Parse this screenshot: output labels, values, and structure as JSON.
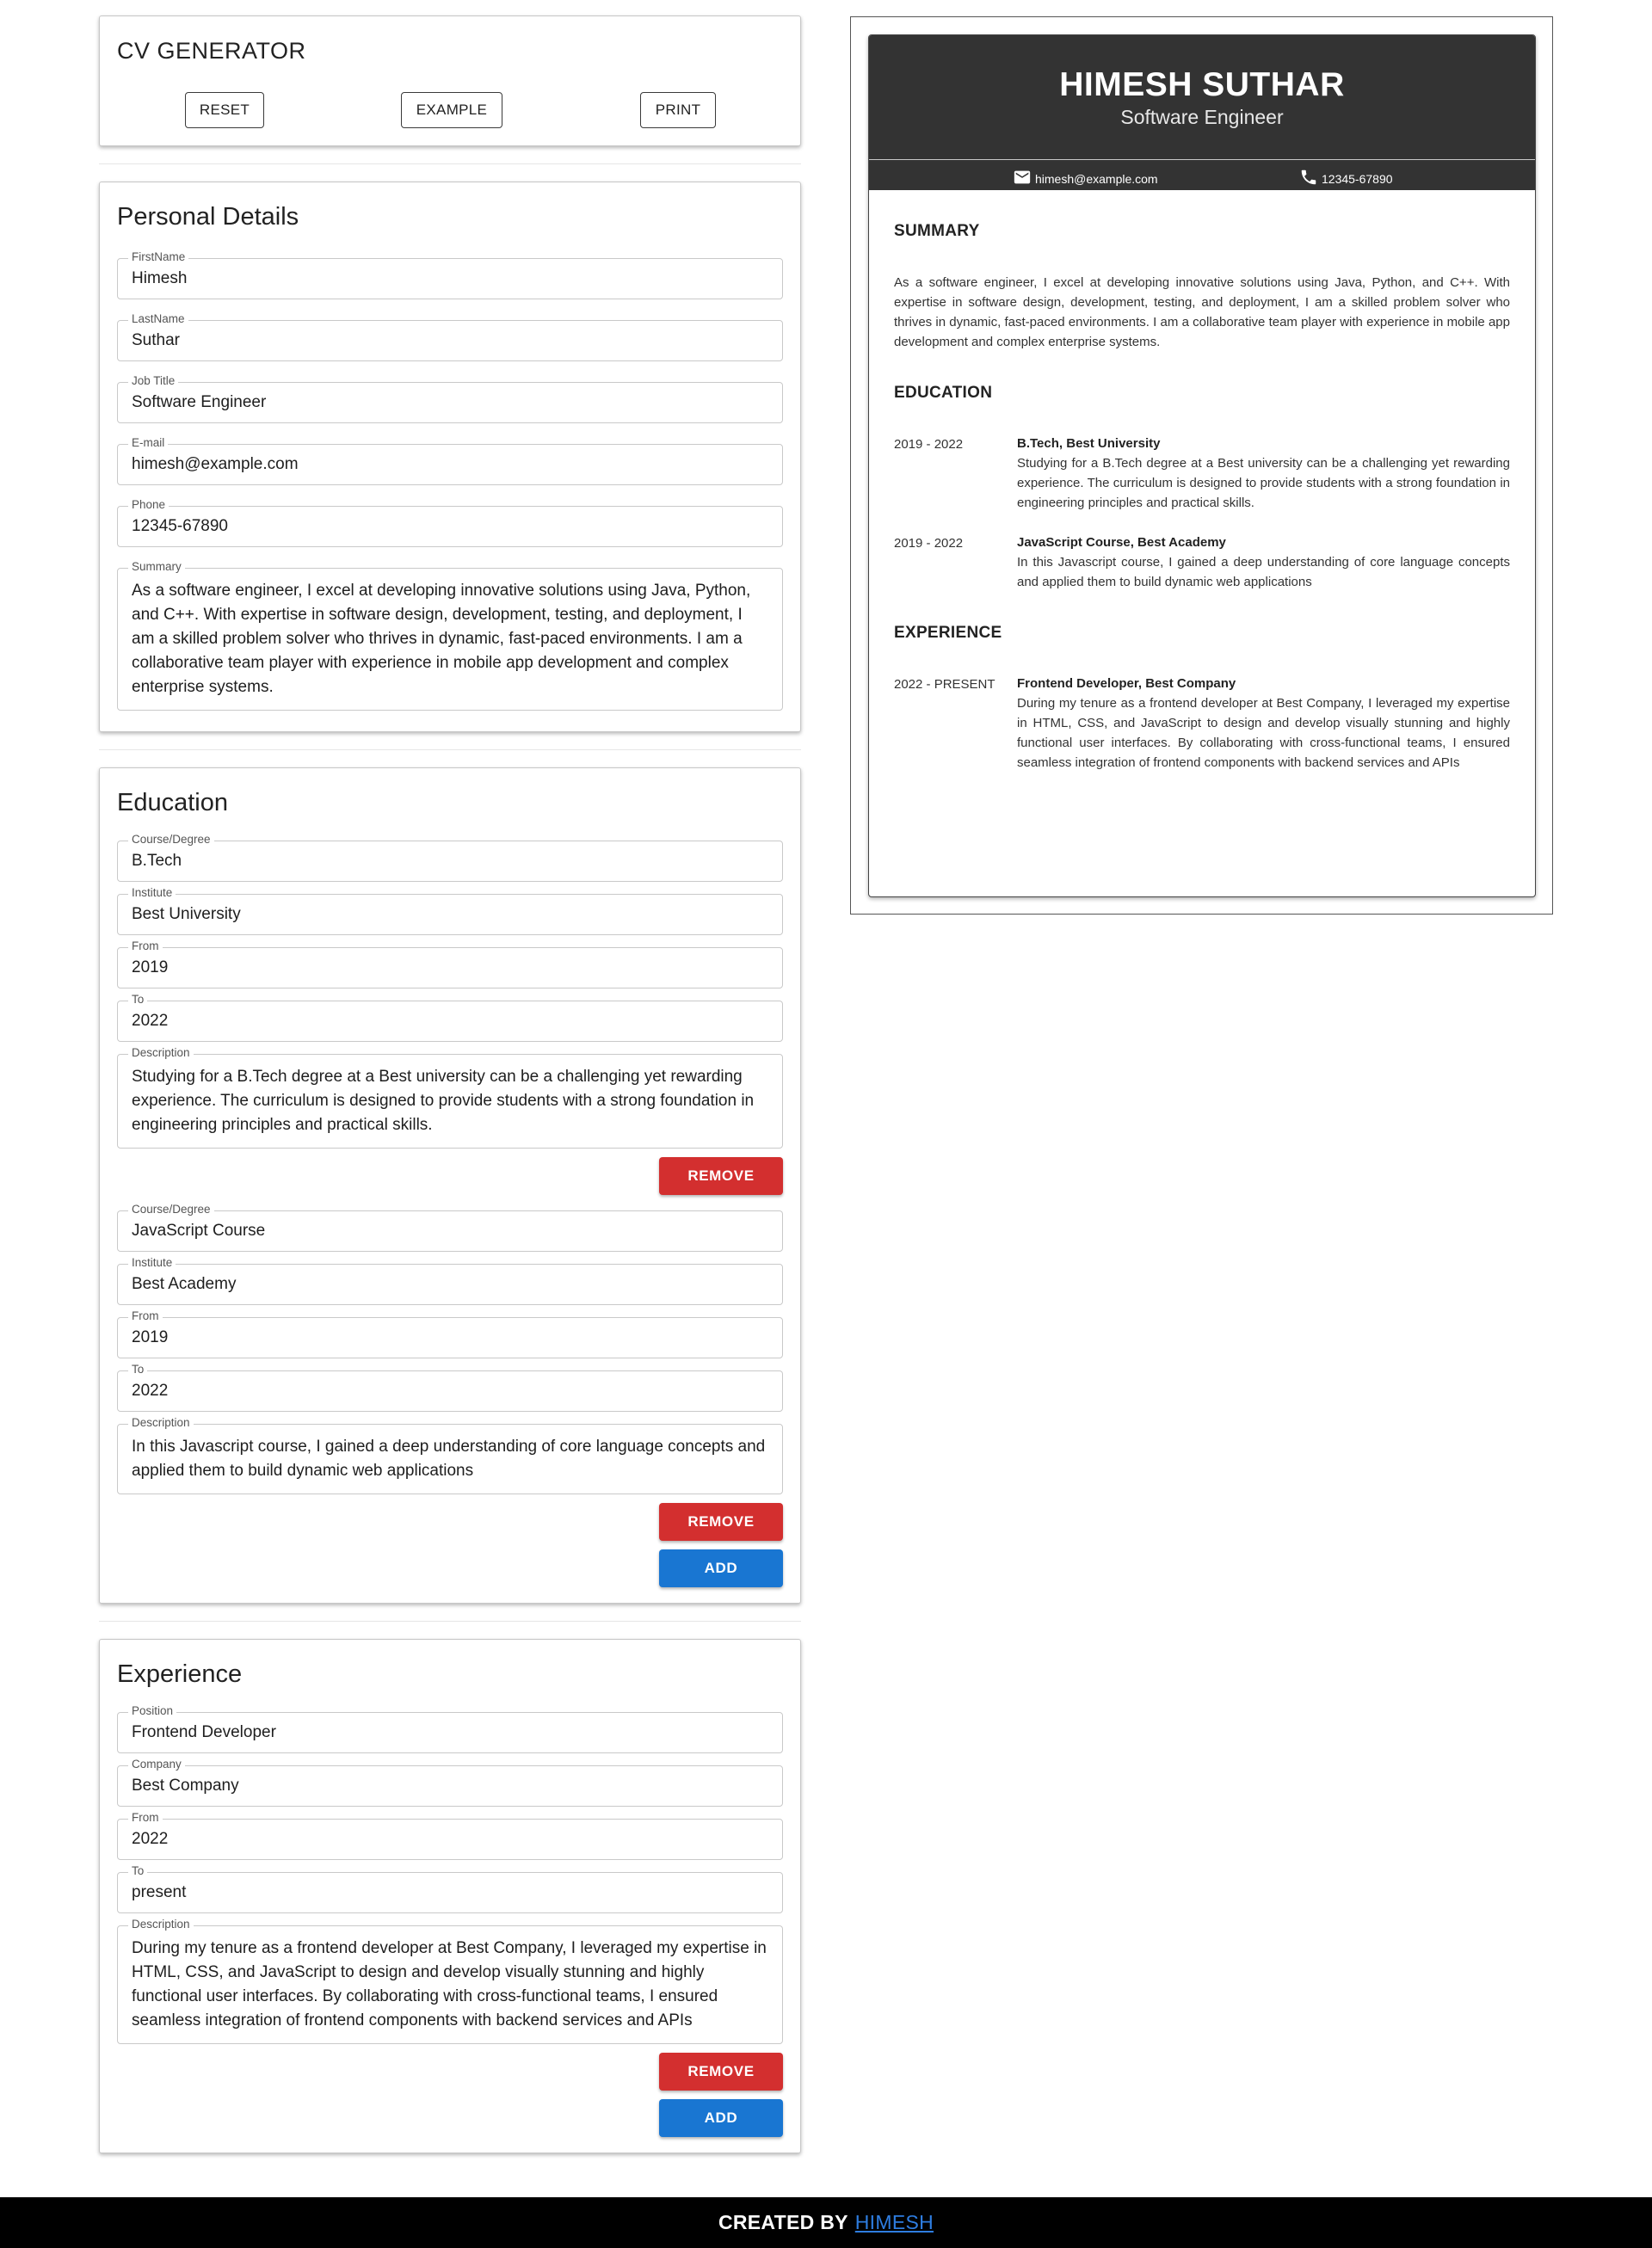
{
  "app": {
    "title": "CV GENERATOR",
    "reset_label": "RESET",
    "example_label": "EXAMPLE",
    "print_label": "PRINT"
  },
  "personal": {
    "heading": "Personal Details",
    "fields": [
      {
        "label": "FirstName",
        "value": "Himesh"
      },
      {
        "label": "LastName",
        "value": "Suthar"
      },
      {
        "label": "Job Title",
        "value": "Software Engineer"
      },
      {
        "label": "E-mail",
        "value": "himesh@example.com"
      },
      {
        "label": "Phone",
        "value": "12345-67890"
      }
    ],
    "summary_label": "Summary",
    "summary_value": "As a software engineer, I excel at developing innovative solutions using Java, Python, and C++. With expertise in software design, development, testing, and deployment, I am a skilled problem solver who thrives in dynamic, fast-paced environments. I am a collaborative team player with experience in mobile app development and complex enterprise systems."
  },
  "education": {
    "heading": "Education",
    "course_label": "Course/Degree",
    "institute_label": "Institute",
    "from_label": "From",
    "to_label": "To",
    "description_label": "Description",
    "remove_label": "REMOVE",
    "add_label": "ADD",
    "entries": [
      {
        "course": "B.Tech",
        "institute": "Best University",
        "from": "2019",
        "to": "2022",
        "description": "Studying for a B.Tech degree at a Best university can be a challenging yet rewarding experience. The curriculum is designed to provide students with a strong foundation in engineering principles and practical skills."
      },
      {
        "course": "JavaScript Course",
        "institute": "Best Academy",
        "from": "2019",
        "to": "2022",
        "description": "In this Javascript course, I gained a deep understanding of core language concepts and applied them to build dynamic web applications"
      }
    ]
  },
  "experience": {
    "heading": "Experience",
    "position_label": "Position",
    "company_label": "Company",
    "from_label": "From",
    "to_label": "To",
    "description_label": "Description",
    "remove_label": "REMOVE",
    "add_label": "ADD",
    "entries": [
      {
        "position": "Frontend Developer",
        "company": "Best Company",
        "from": "2022",
        "to": "present",
        "description": "During my tenure as a frontend developer at Best Company, I leveraged my expertise in HTML, CSS, and JavaScript to design and develop visually stunning and highly functional user interfaces. By collaborating with cross-functional teams, I ensured seamless integration of frontend components with backend services and APIs"
      }
    ]
  },
  "preview": {
    "name": "HIMESH SUTHAR",
    "job": "Software Engineer",
    "email": "himesh@example.com",
    "phone": "12345-67890",
    "summary_title": "SUMMARY",
    "summary": "As a software engineer, I excel at developing innovative solutions using Java, Python, and C++. With expertise in software design, development, testing, and deployment, I am a skilled problem solver who thrives in dynamic, fast-paced environments. I am a collaborative team player with experience in mobile app development and complex enterprise systems.",
    "education_title": "EDUCATION",
    "education": [
      {
        "date": "2019 - 2022",
        "title": "B.Tech, Best University",
        "description": "Studying for a B.Tech degree at a Best university can be a challenging yet rewarding experience. The curriculum is designed to provide students with a strong foundation in engineering principles and practical skills."
      },
      {
        "date": "2019 - 2022",
        "title": "JavaScript Course, Best Academy",
        "description": "In this Javascript course, I gained a deep understanding of core language concepts and applied them to build dynamic web applications"
      }
    ],
    "experience_title": "EXPERIENCE",
    "experience": [
      {
        "date": "2022 - PRESENT",
        "title": "Frontend Developer, Best Company",
        "description": "During my tenure as a frontend developer at Best Company, I leveraged my expertise in HTML, CSS, and JavaScript to design and develop visually stunning and highly functional user interfaces. By collaborating with cross-functional teams, I ensured seamless integration of frontend components with backend services and APIs"
      }
    ]
  },
  "footer": {
    "prefix": "CREATED BY",
    "link": "HIMESH"
  },
  "colors": {
    "remove": "#d32f2f",
    "add": "#1976d2",
    "preview_header": "#333333",
    "footer_link": "#2e7de0"
  },
  "icons": {
    "email": "mail-icon",
    "phone": "phone-icon"
  }
}
